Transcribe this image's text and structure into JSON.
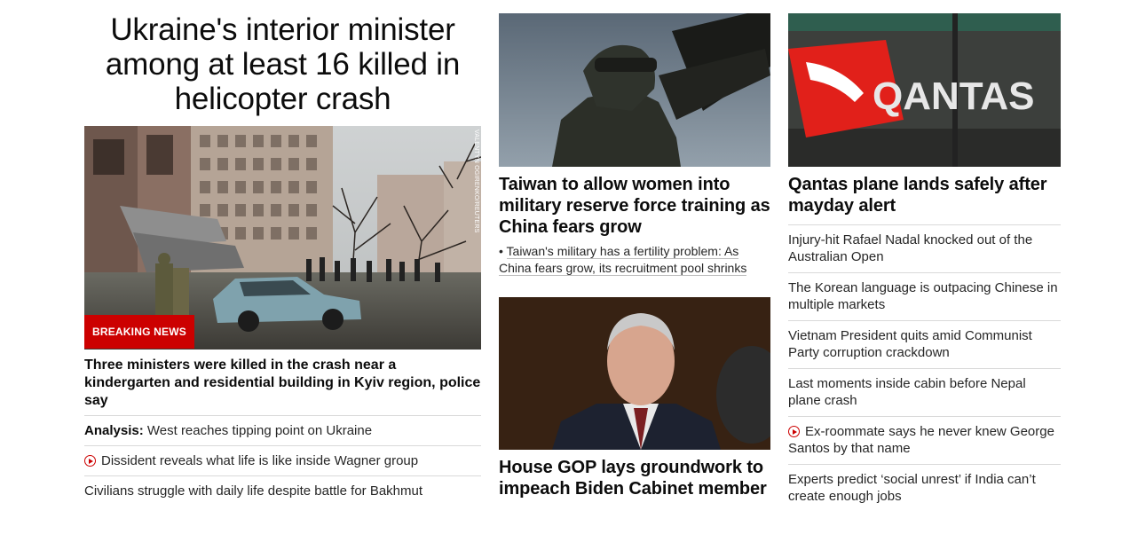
{
  "lead": {
    "headline": "Ukraine's interior minister among at least 16 killed in helicopter crash",
    "badge": "BREAKING NEWS",
    "photo_credit": "VALENTYN OGIRENKO/REUTERS",
    "summary": "Three ministers were killed in the crash near a kindergarten and residential building in Kyiv region, police say",
    "links": [
      {
        "prefix": "Analysis:",
        "text": "West reaches tipping point on Ukraine",
        "video": false
      },
      {
        "prefix": "",
        "text": "Dissident reveals what life is like inside Wagner group",
        "video": true
      },
      {
        "prefix": "",
        "text": "Civilians struggle with daily life despite battle for Bakhmut",
        "video": false
      }
    ]
  },
  "middle": {
    "story1": {
      "title": "Taiwan to allow women into military reserve force training as China fears grow",
      "bullet": "Taiwan's military has a fertility problem: As China fears grow, its recruitment pool shrinks"
    },
    "story2": {
      "title": "House GOP lays groundwork to impeach Biden Cabinet member"
    }
  },
  "right": {
    "top": {
      "image_sign": "QANTAS",
      "title": "Qantas plane lands safely after mayday alert"
    },
    "links": [
      {
        "text": "Injury-hit Rafael Nadal knocked out of the Australian Open",
        "video": false
      },
      {
        "text": "The Korean language is outpacing Chinese in multiple markets",
        "video": false
      },
      {
        "text": "Vietnam President quits amid Communist Party corruption crackdown",
        "video": false
      },
      {
        "text": "Last moments inside cabin before Nepal plane crash",
        "video": false
      },
      {
        "text": "Ex-roommate says he never knew George Santos by that name",
        "video": true
      },
      {
        "text": "Experts predict ‘social unrest’ if India can’t create enough jobs",
        "video": false
      }
    ]
  },
  "colors": {
    "accent": "#cc0000",
    "text": "#0c0c0c",
    "divider": "#d9d9d9"
  }
}
